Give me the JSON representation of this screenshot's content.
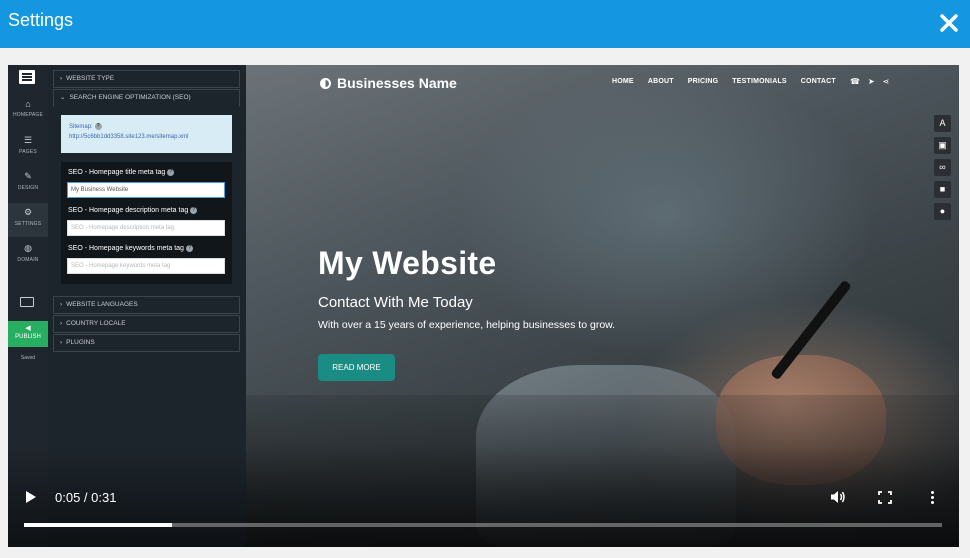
{
  "window": {
    "title": "Settings"
  },
  "sidebar": {
    "items": [
      {
        "label": "HOMEPAGE",
        "icon": "home-icon"
      },
      {
        "label": "PAGES",
        "icon": "pages-icon"
      },
      {
        "label": "DESIGN",
        "icon": "brush-icon"
      },
      {
        "label": "SETTINGS",
        "icon": "gear-icon"
      },
      {
        "label": "DOMAIN",
        "icon": "globe-icon"
      }
    ],
    "publish_label": "PUBLISH",
    "saved_label": "Saved"
  },
  "panel": {
    "sections": {
      "website_type": "WEBSITE TYPE",
      "seo": "SEARCH ENGINE OPTIMIZATION (SEO)",
      "website_languages": "WEBSITE LANGUAGES",
      "country_locale": "COUNTRY LOCALE",
      "plugins": "PLUGINS"
    },
    "sitemap": {
      "label": "Sitemap:",
      "url": "http://5c6bb1dd3358.site123.me/sitemap.xml"
    },
    "seo_fields": {
      "title_label": "SEO - Homepage title meta tag",
      "title_value": "My Business Website",
      "description_label": "SEO - Homepage description meta tag",
      "description_placeholder": "SEO - Homepage description meta tag",
      "keywords_label": "SEO - Homepage keywords meta tag",
      "keywords_placeholder": "SEO - Homepage keywords meta tag"
    }
  },
  "site": {
    "brand": "Businesses Name",
    "nav": [
      "HOME",
      "ABOUT",
      "PRICING",
      "TESTIMONIALS",
      "CONTACT"
    ],
    "hero_title": "My Website",
    "hero_subtitle": "Contact With Me Today",
    "hero_description": "With over a 15 years of experience, helping businesses to grow.",
    "cta_label": "READ MORE"
  },
  "video": {
    "time_display": "0:05 / 0:31",
    "progress_fraction": 0.161
  }
}
